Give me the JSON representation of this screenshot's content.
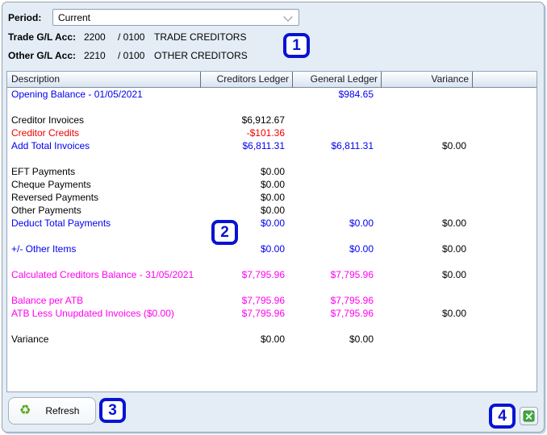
{
  "colors": {
    "black": "#000000",
    "blue": "#0000f0",
    "red": "#f00000",
    "magenta": "#ff00f0",
    "badge_blue": "#0713d2",
    "excel_green": "#3da83d"
  },
  "period": {
    "label": "Period:",
    "value": "Current"
  },
  "accounts": [
    {
      "label": "Trade G/L Acc:",
      "account": "2200",
      "sub_account": "/ 0100",
      "name": "TRADE CREDITORS"
    },
    {
      "label": "Other G/L Acc:",
      "account": "2210",
      "sub_account": "/ 0100",
      "name": "OTHER CREDITORS"
    }
  ],
  "table": {
    "columns": [
      "Description",
      "Creditors Ledger",
      "General Ledger",
      "Variance"
    ],
    "rows": [
      {
        "label": {
          "text": "Opening Balance - 01/05/2021",
          "color": "blue"
        },
        "general": {
          "text": "$984.65",
          "color": "blue"
        }
      },
      {
        "blank": true
      },
      {
        "label": {
          "text": "Creditor Invoices",
          "color": "black"
        },
        "creditors": {
          "text": "$6,912.67",
          "color": "black"
        }
      },
      {
        "label": {
          "text": "Creditor Credits",
          "color": "red"
        },
        "creditors": {
          "text": "-$101.36",
          "color": "red"
        }
      },
      {
        "label": {
          "text": "Add Total Invoices",
          "color": "blue"
        },
        "creditors": {
          "text": "$6,811.31",
          "color": "blue"
        },
        "general": {
          "text": "$6,811.31",
          "color": "blue"
        },
        "variance": {
          "text": "$0.00",
          "color": "black"
        }
      },
      {
        "blank": true
      },
      {
        "label": {
          "text": "EFT Payments",
          "color": "black"
        },
        "creditors": {
          "text": "$0.00",
          "color": "black"
        }
      },
      {
        "label": {
          "text": "Cheque Payments",
          "color": "black"
        },
        "creditors": {
          "text": "$0.00",
          "color": "black"
        }
      },
      {
        "label": {
          "text": "Reversed Payments",
          "color": "black"
        },
        "creditors": {
          "text": "$0.00",
          "color": "black"
        }
      },
      {
        "label": {
          "text": "Other Payments",
          "color": "black"
        },
        "creditors": {
          "text": "$0.00",
          "color": "black"
        }
      },
      {
        "label": {
          "text": "Deduct Total Payments",
          "color": "blue"
        },
        "creditors": {
          "text": "$0.00",
          "color": "blue"
        },
        "general": {
          "text": "$0.00",
          "color": "blue"
        },
        "variance": {
          "text": "$0.00",
          "color": "black"
        }
      },
      {
        "blank": true
      },
      {
        "label": {
          "text": "+/- Other Items",
          "color": "blue"
        },
        "creditors": {
          "text": "$0.00",
          "color": "blue"
        },
        "general": {
          "text": "$0.00",
          "color": "blue"
        },
        "variance": {
          "text": "$0.00",
          "color": "black"
        }
      },
      {
        "blank": true
      },
      {
        "label": {
          "text": "Calculated Creditors Balance - 31/05/2021",
          "color": "magenta"
        },
        "creditors": {
          "text": "$7,795.96",
          "color": "magenta"
        },
        "general": {
          "text": "$7,795.96",
          "color": "magenta"
        },
        "variance": {
          "text": "$0.00",
          "color": "black"
        }
      },
      {
        "blank": true
      },
      {
        "label": {
          "text": "Balance per ATB",
          "color": "magenta"
        },
        "creditors": {
          "text": "$7,795.96",
          "color": "magenta"
        },
        "general": {
          "text": "$7,795.96",
          "color": "magenta"
        }
      },
      {
        "label": {
          "text": "ATB Less Unupdated Invoices ($0.00)",
          "color": "magenta"
        },
        "creditors": {
          "text": "$7,795.96",
          "color": "magenta"
        },
        "general": {
          "text": "$7,795.96",
          "color": "magenta"
        },
        "variance": {
          "text": "$0.00",
          "color": "black"
        }
      },
      {
        "blank": true
      },
      {
        "label": {
          "text": "Variance",
          "color": "black"
        },
        "creditors": {
          "text": "$0.00",
          "color": "black"
        },
        "general": {
          "text": "$0.00",
          "color": "black"
        }
      }
    ]
  },
  "footer": {
    "refresh_label": "Refresh"
  },
  "annotations": {
    "badges": [
      {
        "label": "1"
      },
      {
        "label": "2"
      },
      {
        "label": "3"
      },
      {
        "label": "4"
      }
    ]
  }
}
